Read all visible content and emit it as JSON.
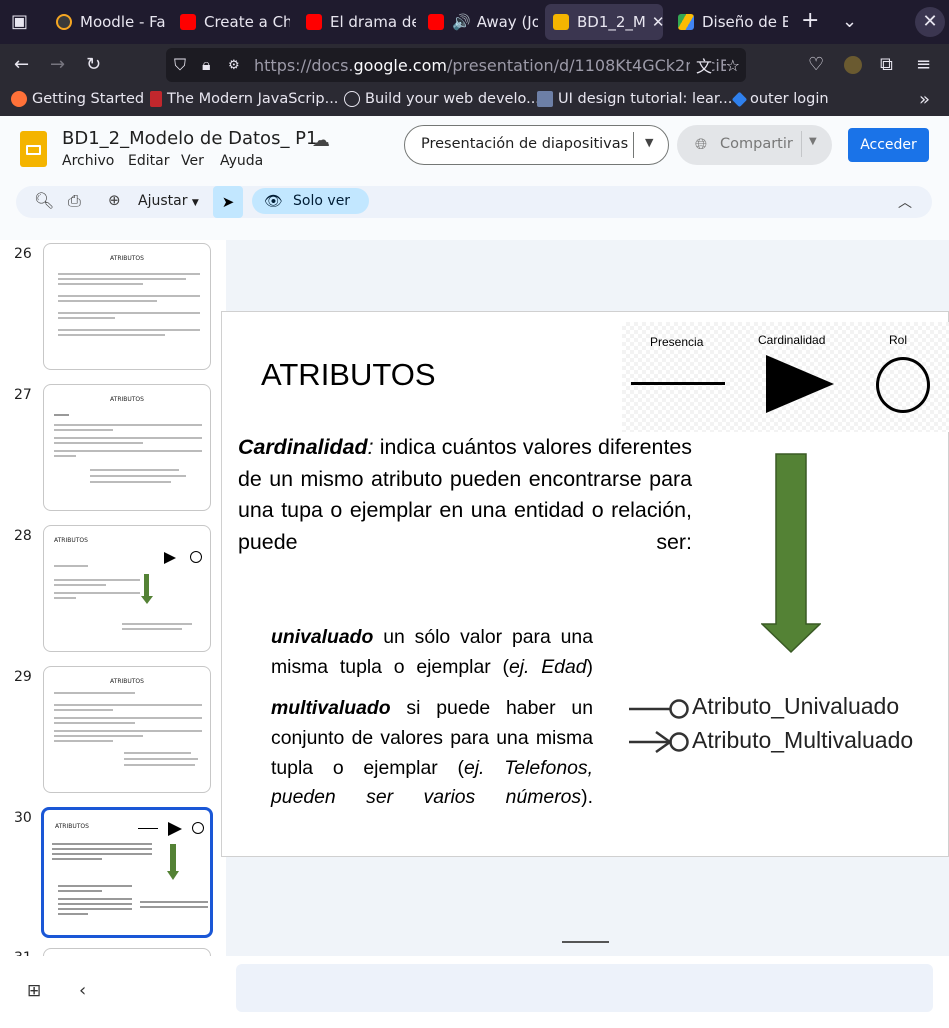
{
  "browser": {
    "tabs": [
      {
        "title": "Moodle - Fa",
        "color": "#f5a623"
      },
      {
        "title": "Create a Che",
        "color": "#ff0000"
      },
      {
        "title": "El drama de",
        "color": "#ff0000"
      },
      {
        "title": "Away (Jo",
        "color": "#ff0000"
      },
      {
        "title": "BD1_2_M",
        "color": "#f4b400"
      },
      {
        "title": "Diseño de B",
        "color": "#34a853"
      }
    ],
    "url_prefix": "https://docs.",
    "url_domain": "google.com",
    "url_rest": "/presentation/d/1108Kt4GCk2m-ciE",
    "bookmarks": [
      "Getting Started",
      "The Modern JavaScrip...",
      "Build your web develo...",
      "UI design tutorial: lear...",
      "outer login"
    ]
  },
  "app": {
    "title": "BD1_2_Modelo de Datos_ P1",
    "menu": [
      "Archivo",
      "Editar",
      "Ver",
      "Ayuda"
    ],
    "present_button": "Presentación de diapositivas",
    "share_button": "Compartir",
    "access_button": "Acceder",
    "zoom_label": "Ajustar",
    "view_mode": "Solo ver"
  },
  "filmstrip": {
    "numbers": [
      "26",
      "27",
      "28",
      "29",
      "30",
      "31"
    ],
    "titles": [
      "ATRIBUTOS",
      "ATRIBUTOS",
      "ATRIBUTOS",
      "ATRIBUTOS",
      "ATRIBUTOS"
    ]
  },
  "slide": {
    "title": "ATRIBUTOS",
    "legend": {
      "presence": "Presencia",
      "cardinality": "Cardinalidad",
      "role": "Rol"
    },
    "def_term": "Cardinalidad",
    "def_colon": ":",
    "def_text": " indica cuántos valores diferentes de un mismo atributo pueden encontrarse para una tupa o ejemplar en una entidad o relación, puede ser:",
    "uni_term": "univaluado",
    "uni_text": " un sólo valor para una misma tupla o ejemplar (",
    "uni_example": "ej. Edad",
    "uni_close": ")",
    "multi_term": "multivaluado",
    "multi_text": " si puede haber un conjunto de valores para una misma tupla o ejemplar (",
    "multi_example": "ej. Telefonos, pueden ser varios números",
    "multi_close": ").",
    "attr_uni": "Atributo_Univaluado",
    "attr_multi": "Atributo_Multivaluado",
    "arrow_color": "#548235"
  }
}
